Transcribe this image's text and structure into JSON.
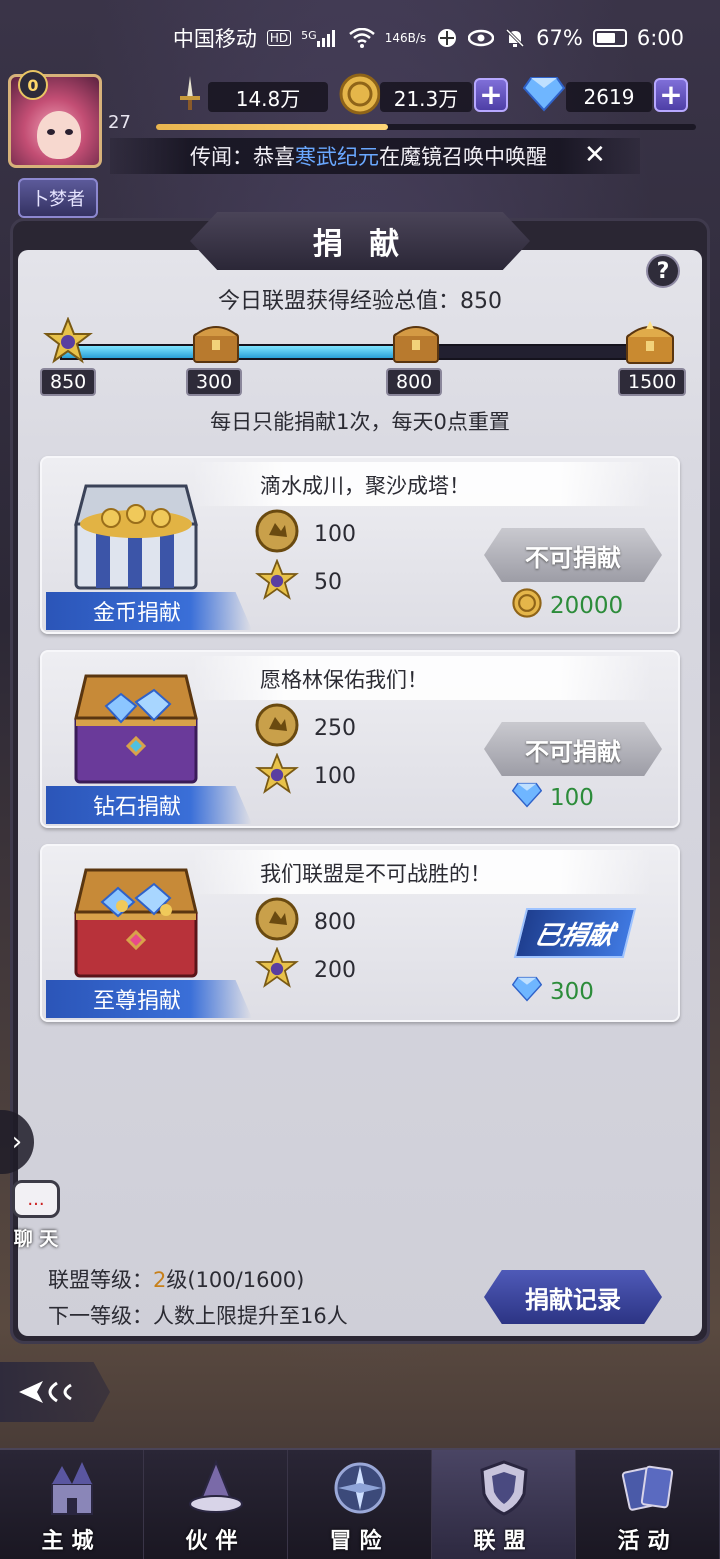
{
  "status_bar": {
    "carrier": "中国移动",
    "hd": "HD",
    "net": "5G",
    "speed_value": "146",
    "speed_unit": "B/s",
    "battery": "67%",
    "time": "6:00"
  },
  "player": {
    "vip_level": "0",
    "level": "27",
    "title_badge": "卜梦者",
    "power": "14.8万",
    "gold": "21.3万",
    "diamonds": "2619",
    "xp_fraction": 0.43
  },
  "news": {
    "prefix": "传闻：恭喜",
    "highlight": "寒武纪元",
    "suffix": "在魔镜召唤中唤醒"
  },
  "panel": {
    "title": "捐 献",
    "total_exp_label": "今日联盟获得经验总值：850",
    "rule_text": "每日只能捐献1次，每天0点重置",
    "progress_fraction": 0.56,
    "milestones": [
      "850",
      "300",
      "800",
      "1500"
    ]
  },
  "donations": [
    {
      "name": "金币捐献",
      "slogan": "滴水成川，聚沙成塔！",
      "reward_a": "100",
      "reward_b": "50",
      "button": "不可捐献",
      "cost": "20000",
      "cost_icon": "gold-coin-icon"
    },
    {
      "name": "钻石捐献",
      "slogan": "愿格林保佑我们！",
      "reward_a": "250",
      "reward_b": "100",
      "button": "不可捐献",
      "cost": "100",
      "cost_icon": "diamond-icon"
    },
    {
      "name": "至尊捐献",
      "slogan": "我们联盟是不可战胜的！",
      "reward_a": "800",
      "reward_b": "200",
      "button": "已捐献",
      "cost": "300",
      "cost_icon": "diamond-icon"
    }
  ],
  "alliance": {
    "level_label": "联盟等级：",
    "level_value": "2",
    "level_suffix": "级(100/1600)",
    "next_level": "下一等级：人数上限提升至16人",
    "record_button": "捐献记录"
  },
  "chat": {
    "label": "聊 天",
    "badge": "..."
  },
  "nav": [
    {
      "label": "主城",
      "icon": "castle-icon"
    },
    {
      "label": "伙伴",
      "icon": "witch-hat-icon"
    },
    {
      "label": "冒险",
      "icon": "compass-icon"
    },
    {
      "label": "联盟",
      "icon": "shield-icon"
    },
    {
      "label": "活动",
      "icon": "cards-icon"
    }
  ],
  "colors": {
    "accent_blue": "#3a6fd8",
    "cost_green": "#2c8c3a",
    "level_orange": "#c7801a",
    "news_highlight": "#6aa8ff"
  }
}
